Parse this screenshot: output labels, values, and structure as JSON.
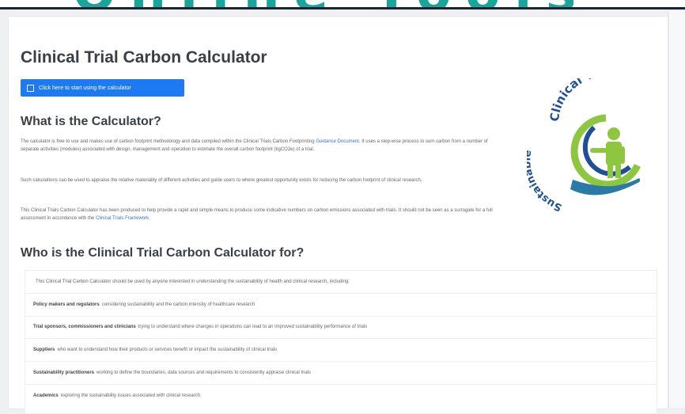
{
  "banner": {
    "text": "Online Tools"
  },
  "page": {
    "title": "Clinical Trial Carbon Calculator",
    "start_button": "Click here to start using the calculator"
  },
  "what": {
    "heading": "What is the Calculator?",
    "p1_text": "The calculator is free to use and makes use of carbon footprint methodology and data compiled within the Clinical Trials Carbon Footprinting ",
    "p1_link": "Guidance Document",
    "p1_text2": ". It uses a step-wise process to sum carbon from a number of separate activities (modules) associated with design, management and operation to estimate the overall carbon footprint (kgCO2e) of a trial.",
    "p2": "Such calculations can be used to appraise the relative materiality of different activities and guide users to where greatest opportunity exists for reducing the carbon footprint of clinical research.",
    "p3_text": "This Clinical Trials Carbon Calculator has been produced to help provide a rapid and simple means to produce some indicative numbers on carbon emissions associated with trials. It should not be seen as a surrogate for a full assessment in accordance with the ",
    "p3_link": "Clinical Trials Framework",
    "p3_text2": "."
  },
  "logo": {
    "text_top": "Clinical Trials",
    "text_left": "Sustainable",
    "colors": {
      "green": "#8dc63f",
      "blue": "#1f4f97",
      "teal": "#2a7aa8"
    }
  },
  "who": {
    "heading": "Who is the Clinical Trial Carbon Calculator for?",
    "rows": [
      {
        "bold": "",
        "text": "This Clinical Trial Carbon Calculator should be used by anyone interested in understanding the sustainability of health and clinical research, including:"
      },
      {
        "bold": "Policy makers and regulators",
        "text": "considering sustainability and the carbon intensity of healthcare research"
      },
      {
        "bold": "Trial sponsors, commissioners and clinicians",
        "text": "trying to understand where changes in operations can lead to an improved sustainability performance of trials"
      },
      {
        "bold": "Suppliers",
        "text": "who want to understand how their products or services benefit or impact the sustainability of clinical trials"
      },
      {
        "bold": "Sustainability practitioners",
        "text": "working to define the boundaries, data sources and requirements to consistently appraise clinical trials"
      },
      {
        "bold": "Academics",
        "text": "exploring the sustainability issues associated with clinical research"
      }
    ]
  }
}
